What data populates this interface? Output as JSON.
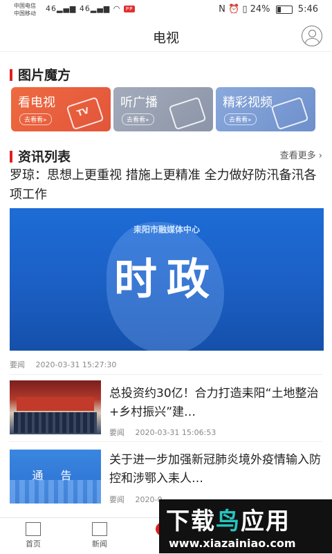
{
  "status_bar": {
    "carrier_1": "中国电信",
    "carrier_2": "中国移动",
    "net_1": "46",
    "net_2": "46",
    "badge": "PP",
    "nfc": "N",
    "battery": "24%",
    "time": "5:46"
  },
  "header": {
    "title": "电视"
  },
  "section_cube": {
    "title": "图片魔方"
  },
  "cubes": [
    {
      "label": "看电视",
      "sub": "去看看»",
      "icon_text": "TV",
      "color": "#e8643c"
    },
    {
      "label": "听广播",
      "sub": "去看看»",
      "icon_text": "",
      "color": "#9aa3b4"
    },
    {
      "label": "精彩视频",
      "sub": "去看看»",
      "icon_text": "",
      "color": "#7e9ed2"
    }
  ],
  "section_news": {
    "title": "资讯列表",
    "more": "查看更多 ›"
  },
  "top_news": {
    "title": "罗琼：思想上更重视 措施上更精准 全力做好防汛备汛各项工作",
    "banner_org": "耒阳市融媒体中心",
    "banner_text": "时政",
    "tag": "要闻",
    "time": "2020-03-31 15:27:30"
  },
  "news": [
    {
      "title": "总投资约30亿！合力打造耒阳“土地整治+乡村振兴”建…",
      "tag": "要闻",
      "time": "2020-03-31 15:06:53"
    },
    {
      "title": "关于进一步加强新冠肺炎境外疫情输入防控和涉鄂入耒人…",
      "tag": "要闻",
      "time": "2020-0",
      "thumb_text": "通 告"
    }
  ],
  "tabbar": {
    "items": [
      {
        "label": "首页"
      },
      {
        "label": "新闻"
      },
      {
        "label": "电"
      }
    ]
  },
  "watermark": {
    "brand_1": "下载",
    "brand_2": "鸟",
    "brand_3": "应用",
    "url": "www.xiazainiao.com"
  }
}
